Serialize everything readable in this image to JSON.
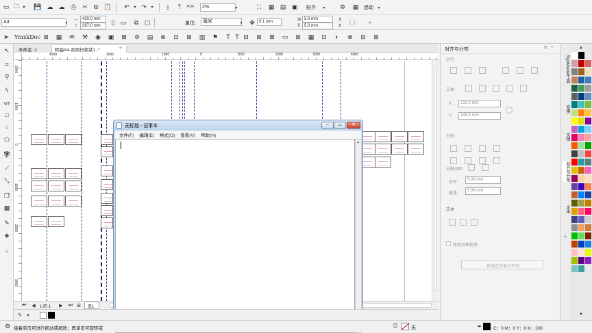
{
  "toolbar1": {
    "zoom_value": "2%",
    "paste_label": "贴齐",
    "launch_label": "启动"
  },
  "propbar": {
    "page_size": "A3",
    "width": "420.0 mm",
    "height": "297.0 mm",
    "unit_label": "单位:",
    "unit_value": "毫米",
    "nudge": "0.1 mm",
    "dup_x": "5.0 mm",
    "dup_y": "5.0 mm"
  },
  "plugin_toolbar": {
    "title": "YmxkDoc"
  },
  "doc_tabs": [
    {
      "label": "未命名 -1"
    },
    {
      "label": "转曲X4-农商行奖状1..*"
    }
  ],
  "ruler": {
    "h_ticks": [
      "4000",
      "3000",
      "1000",
      "0",
      "1000",
      "2000",
      "3000",
      "4000"
    ],
    "v_ticks": [
      "2000",
      "1000",
      "0",
      "1000",
      "2000",
      "3000"
    ]
  },
  "page_nav": {
    "page_label": "页1"
  },
  "notepad": {
    "title": "无标题 - 记事本",
    "menu": [
      "文件(F)",
      "编辑(E)",
      "格式(O)",
      "查看(V)",
      "帮助(H)"
    ],
    "content": ""
  },
  "docker": {
    "title": "对齐与分布",
    "align_label": "对齐",
    "text_label": "文本",
    "x_value": "210.0 mm",
    "y_value": "148.5 mm",
    "distribute_label": "分布",
    "spacing_label": "分配间距",
    "h_spacing": "5.08 mm",
    "v_spacing": "5.08 mm",
    "text_section": "文本",
    "use_outline": "使用对象轮廓",
    "apply_button": "将选定对象对齐到",
    "sections": [
      "对齐",
      "分布",
      "文本"
    ]
  },
  "side_tabs": [
    "SignMaster工具",
    "变换",
    "文档",
    "对齐与分布",
    "文本"
  ],
  "palette": {
    "colors": [
      "#ffffff",
      "#000000",
      "#e8e8e8",
      "#d4a0a0",
      "#c00000",
      "#e06060",
      "#808080",
      "#a06020",
      "#f0e0c0",
      "#c08060",
      "#2060a0",
      "#4080c0",
      "#206040",
      "#40a060",
      "#a0a0a0",
      "#606060",
      "#004080",
      "#6090c0",
      "#008080",
      "#40c0c0",
      "#80c040",
      "#c0e080",
      "#ff8000",
      "#ffc040",
      "#ffff00",
      "#e0e000",
      "#8000a0",
      "#c060c0",
      "#00a0e0",
      "#80d0ff",
      "#e00060",
      "#ff80b0",
      "#ffa0a0",
      "#f06000",
      "#a0e0a0",
      "#00a000",
      "#404040",
      "#c0c0c0",
      "#ff4040",
      "#ff0000",
      "#20a0a0",
      "#608080",
      "#e0c000",
      "#d06000",
      "#ff60c0",
      "#a00060",
      "#ffd0a0",
      "#ffe0c0",
      "#6040a0",
      "#4000c0",
      "#ff8040",
      "#c06030",
      "#0080ff",
      "#2040a0",
      "#606000",
      "#a0a040",
      "#c08000",
      "#e0a000",
      "#ff6080",
      "#ff0060",
      "#404080",
      "#6060c0",
      "#d0d0d0",
      "#909090",
      "#f0a060",
      "#d08040",
      "#00c000",
      "#60e060",
      "#802000",
      "#c04000",
      "#0040c0",
      "#2080e0",
      "#ffc0c0",
      "#ffe0e0",
      "#e0ff00",
      "#a0c000",
      "#600080",
      "#9020c0",
      "#80c0c0",
      "#40a0a0"
    ]
  },
  "status": {
    "hint": "接着单击可进行拖动或缩放；再单击可旋转或",
    "fill_label": "无",
    "color_readout": "C：0 M：0 Y：0 K：100"
  }
}
